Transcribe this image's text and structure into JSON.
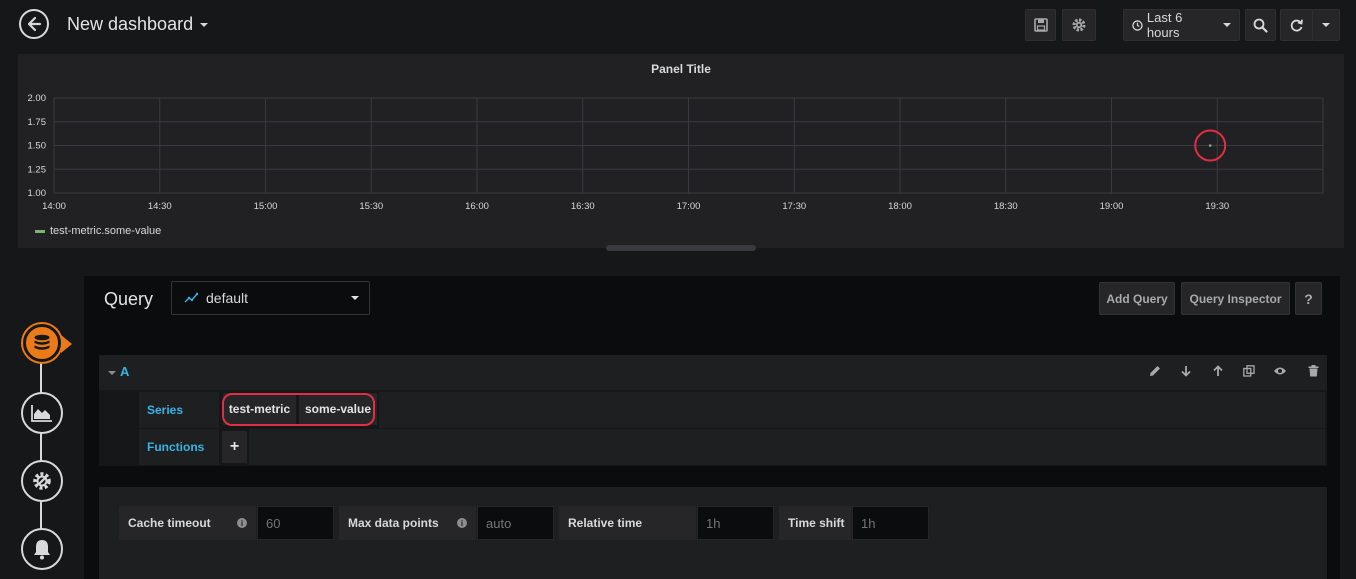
{
  "header": {
    "title": "New dashboard",
    "time_range": "Last 6 hours"
  },
  "panel": {
    "title": "Panel Title",
    "legend": "test-metric.some-value"
  },
  "chart_data": {
    "type": "scatter",
    "title": "Panel Title",
    "x_ticks": [
      "14:00",
      "14:30",
      "15:00",
      "15:30",
      "16:00",
      "16:30",
      "17:00",
      "17:30",
      "18:00",
      "18:30",
      "19:00",
      "19:30"
    ],
    "y_ticks": [
      "2.00",
      "1.75",
      "1.50",
      "1.25",
      "1.00"
    ],
    "ylim": [
      1.0,
      2.0
    ],
    "series": [
      {
        "name": "test-metric.some-value",
        "color": "#7eb26d",
        "points": [
          {
            "x": "19:28",
            "y": 1.5
          }
        ]
      }
    ],
    "grid": true,
    "legend_position": "bottom-left",
    "annotations": [
      "red circle around data point"
    ]
  },
  "editor": {
    "query_label": "Query",
    "datasource": "default",
    "add_query": "Add Query",
    "query_inspector": "Query Inspector",
    "help": "?",
    "query_ref": "A",
    "series_label": "Series",
    "functions_label": "Functions",
    "series_segments": [
      "test-metric",
      "some-value"
    ],
    "add_function": "+"
  },
  "options": {
    "cache_timeout_label": "Cache timeout",
    "cache_timeout_placeholder": "60",
    "max_data_points_label": "Max data points",
    "max_data_points_placeholder": "auto",
    "relative_time_label": "Relative time",
    "relative_time_placeholder": "1h",
    "time_shift_label": "Time shift",
    "time_shift_placeholder": "1h",
    "info": "i"
  },
  "colors": {
    "accent": "#33b5e5",
    "active": "#eb7b18",
    "highlight": "#e02f44",
    "series": "#7eb26d"
  }
}
